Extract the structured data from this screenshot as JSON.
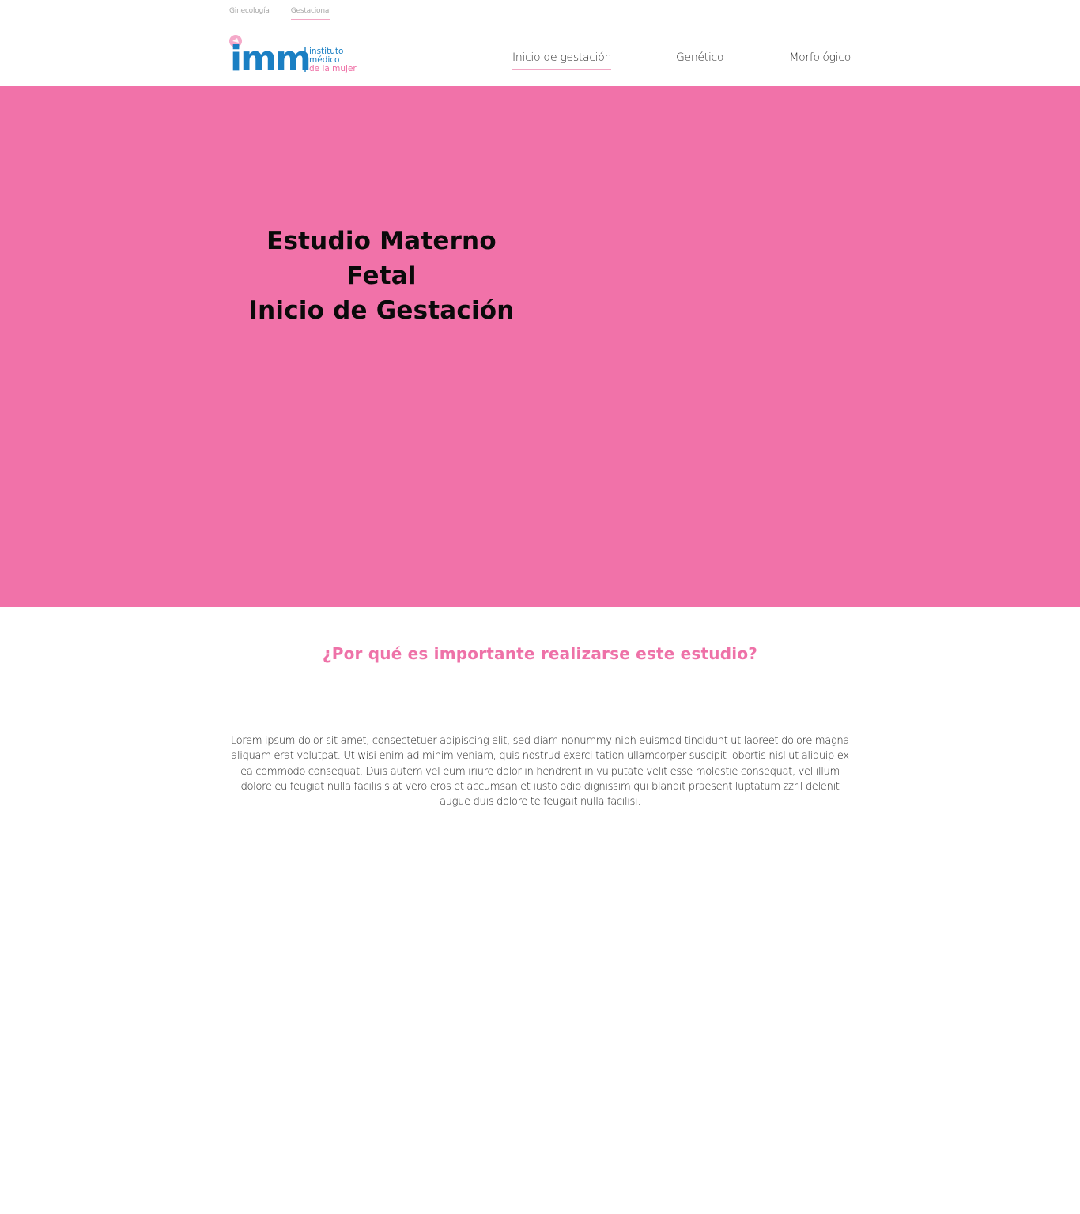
{
  "top_tabs": {
    "ginecologia": "Ginecología",
    "gestacional": "Gestacional"
  },
  "logo": {
    "letters": "imm",
    "line1": "instituto",
    "line2": "médico",
    "line3": "de la mujer",
    "brand_blue": "#1a7fc3",
    "brand_pink": "#f172a9"
  },
  "nav": {
    "item1": "Inicio de gestación",
    "item2": "Genético",
    "item3": "Morfológico"
  },
  "hero": {
    "title_line1": "Estudio Materno Fetal",
    "title_line2": "Inicio de Gestación",
    "background": "#f172a9"
  },
  "section": {
    "heading": "¿Por qué es importante realizarse este estudio?",
    "body": "Lorem ipsum dolor sit amet, consectetuer adipiscing elit, sed diam nonummy nibh euismod tincidunt ut laoreet dolore magna aliquam erat volutpat. Ut wisi enim ad minim veniam, quis nostrud exerci tation ullamcorper suscipit lobortis nisl ut aliquip ex ea commodo consequat. Duis autem vel eum iriure dolor in hendrerit in vulputate velit esse molestie consequat, vel illum dolore eu feugiat nulla facilisis at vero eros et accumsan et iusto odio dignissim qui blandit praesent luptatum zzril delenit augue duis dolore te feugait nulla facilisi."
  }
}
